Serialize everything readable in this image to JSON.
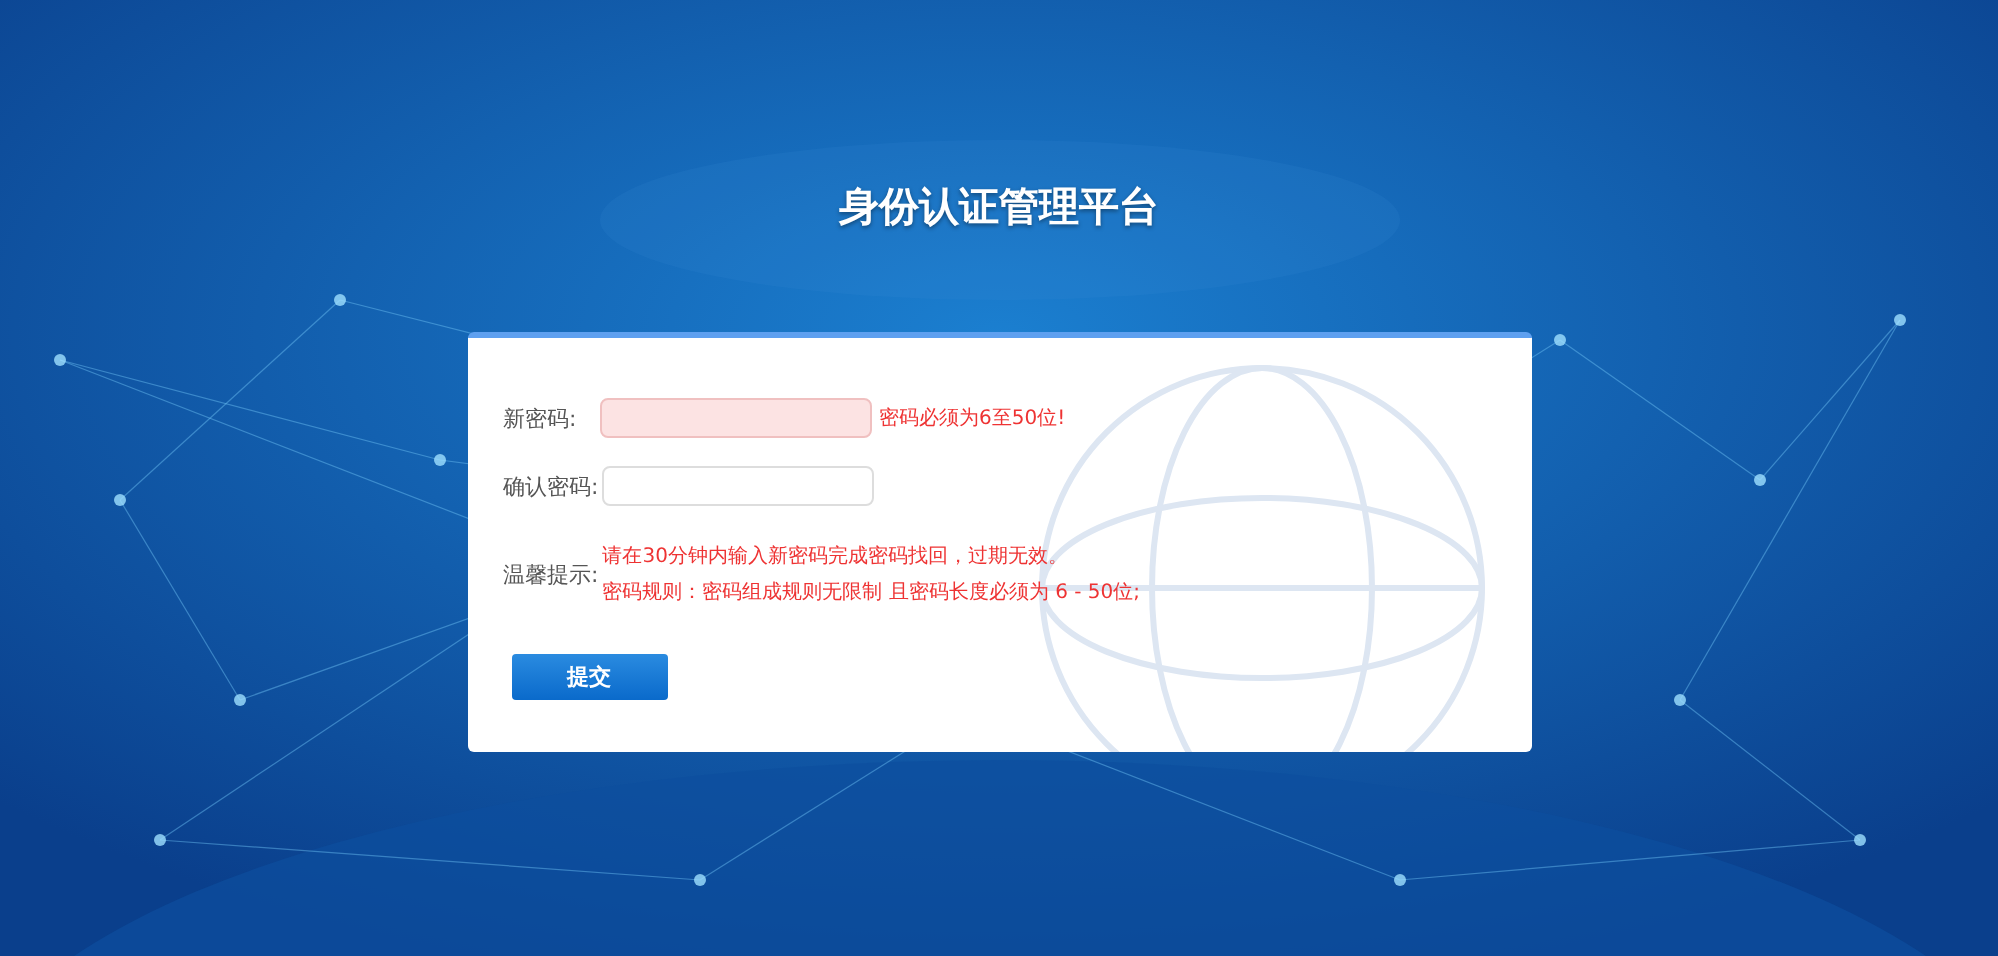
{
  "title": "身份认证管理平台",
  "form": {
    "fields": [
      {
        "label": "新密码:",
        "error": true,
        "message": "密码必须为6至50位!"
      },
      {
        "label": "确认密码:",
        "error": false
      }
    ],
    "hint": {
      "label": "温馨提示:",
      "lines": [
        "请在30分钟内输入新密码完成密码找回，过期无效。",
        "密码规则：密码组成规则无限制 且密码长度必须为 6 - 50位;"
      ]
    },
    "submit": "提交"
  }
}
